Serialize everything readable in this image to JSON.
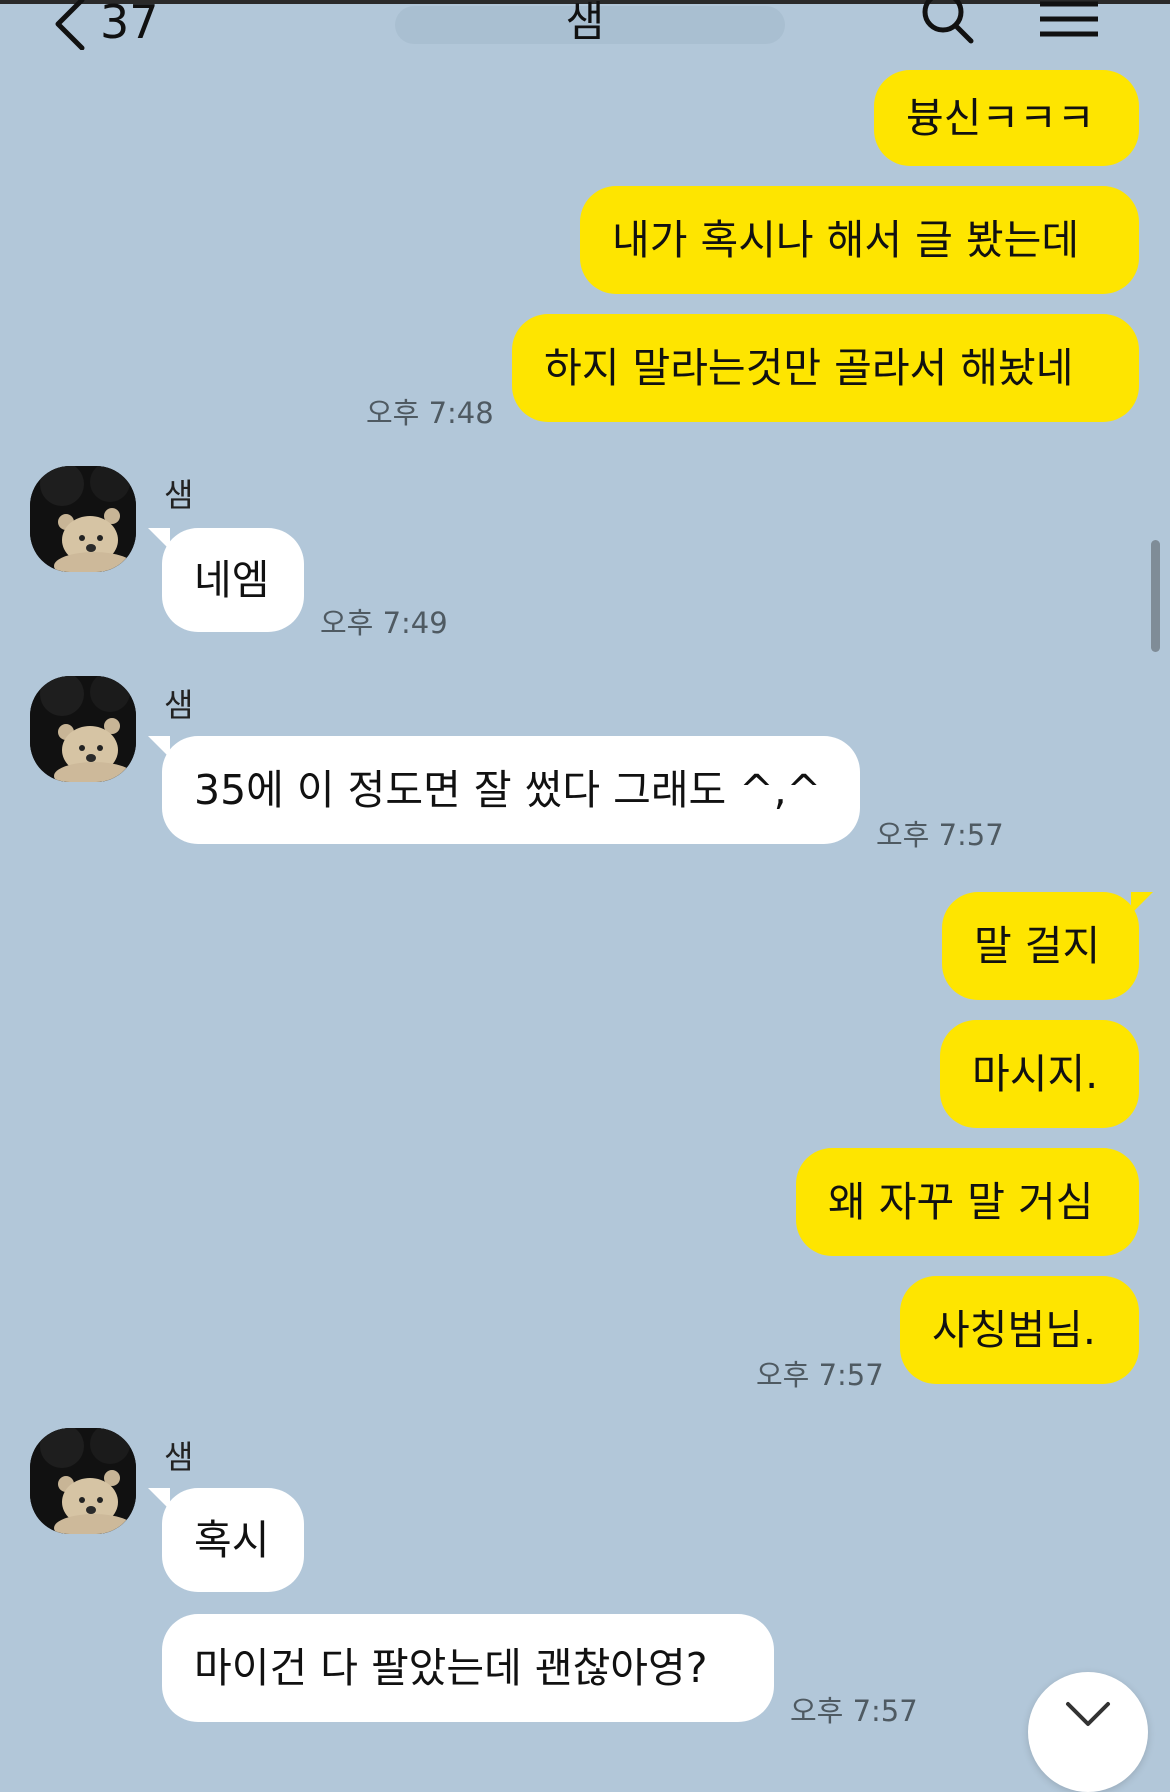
{
  "colors": {
    "background": "#b2c7d9",
    "my_bubble": "#fee500",
    "their_bubble": "#ffffff"
  },
  "header": {
    "back_count": "37",
    "title": "샘",
    "icons": [
      "chevron-left-icon",
      "search-icon",
      "menu-icon"
    ]
  },
  "messages": {
    "m1": "븅신ㅋㅋㅋ",
    "m2": "내가 혹시나 해서 글 봤는데",
    "m3": "하지 말라는것만 골라서 해놨네",
    "m3_time": "오후 7:48",
    "g1_sender": "샘",
    "m4": "네엠",
    "m4_time": "오후 7:49",
    "g2_sender": "샘",
    "m5": "35에 이 정도면 잘 썼다 그래도 ^,^",
    "m5_time": "오후 7:57",
    "m6": "말 걸지",
    "m7": "마시지.",
    "m8": "왜 자꾸 말 거심",
    "m9": "사칭범님.",
    "m9_time": "오후 7:57",
    "g3_sender": "샘",
    "m10": "혹시",
    "m11": "마이건 다 팔았는데 괜찮아영?",
    "m11_time": "오후 7:57"
  }
}
